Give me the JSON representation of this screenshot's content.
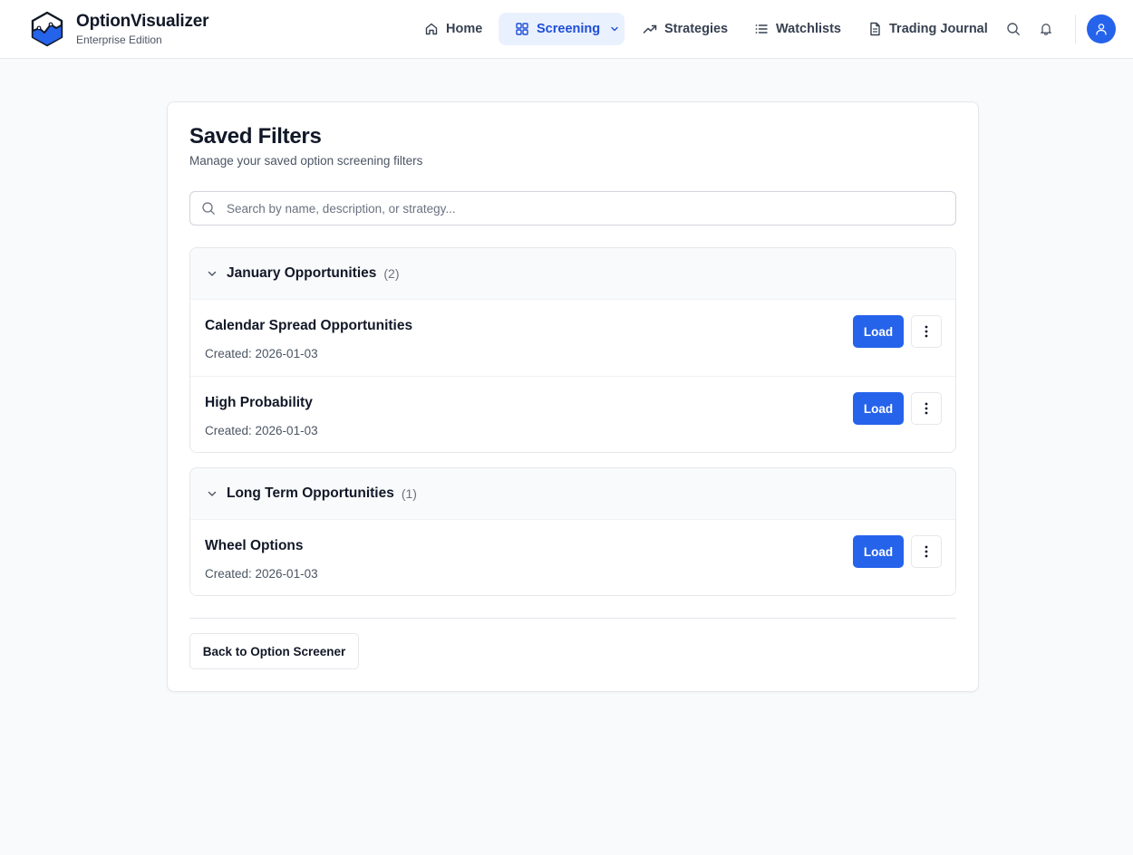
{
  "app": {
    "name": "OptionVisualizer",
    "edition": "Enterprise Edition",
    "logo_icon": "hexagon-chart-logo"
  },
  "nav": {
    "items": [
      {
        "label": "Home",
        "icon": "home-icon"
      },
      {
        "label": "Screening",
        "icon": "grid-icon",
        "active": true,
        "has_dropdown": true
      },
      {
        "label": "Strategies",
        "icon": "trending-up-icon"
      },
      {
        "label": "Watchlists",
        "icon": "list-icon"
      },
      {
        "label": "Trading Journal",
        "icon": "document-icon"
      }
    ]
  },
  "header_actions": {
    "search_icon": "search-icon",
    "notifications_icon": "bell-icon",
    "avatar_icon": "user-icon"
  },
  "page": {
    "title": "Saved Filters",
    "subtitle": "Manage your saved option screening filters",
    "search_placeholder": "Search by name, description, or strategy..."
  },
  "groups": [
    {
      "name": "January Opportunities",
      "count": "(2)",
      "expanded": true,
      "filters": [
        {
          "name": "Calendar Spread Opportunities",
          "created": "Created: 2026-01-03",
          "load_label": "Load"
        },
        {
          "name": "High Probability",
          "created": "Created: 2026-01-03",
          "load_label": "Load"
        }
      ]
    },
    {
      "name": "Long Term Opportunities",
      "count": "(1)",
      "expanded": true,
      "filters": [
        {
          "name": "Wheel Options",
          "created": "Created: 2026-01-03",
          "load_label": "Load"
        }
      ]
    }
  ],
  "footer": {
    "back_label": "Back to Option Screener"
  },
  "colors": {
    "accent": "#2563eb",
    "active_nav_bg": "#eaf1fe",
    "page_bg": "#f9fafb"
  }
}
